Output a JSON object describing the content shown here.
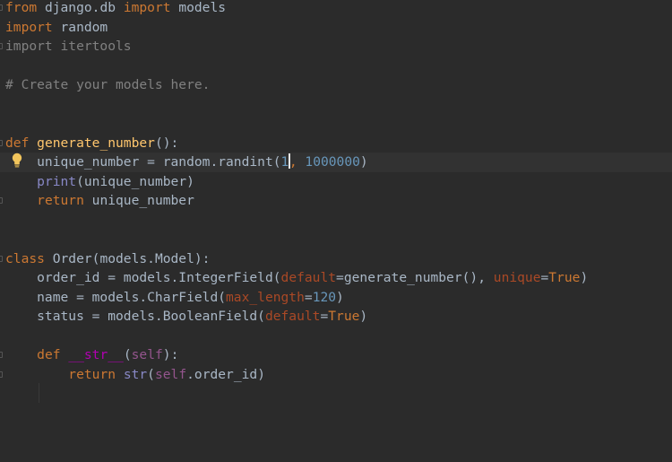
{
  "editor": {
    "lines": {
      "l1": {
        "kw1": "from",
        "mod": " django.db ",
        "kw2": "import",
        "name": " models"
      },
      "l2": {
        "kw": "import",
        "name": " random"
      },
      "l3": {
        "text": "import itertools"
      },
      "l5": {
        "text": "# Create your models here."
      },
      "l8": {
        "kw": "def",
        "sp": " ",
        "fn": "generate_number",
        "rest": "():"
      },
      "l9": {
        "a": "    unique_number = random.randint(",
        "n1": "1",
        "comma": ", ",
        "n2": "1000000",
        "close": ")"
      },
      "l10": {
        "indent": "    ",
        "builtin": "print",
        "rest": "(unique_number)"
      },
      "l11": {
        "indent": "    ",
        "kw": "return",
        "rest": " unique_number"
      },
      "l14": {
        "kw": "class",
        "rest": " Order(models.Model):"
      },
      "l15": {
        "a": "    order_id = models.IntegerField(",
        "kw1": "default",
        "b": "=generate_number(), ",
        "kw2": "unique",
        "eq": "=",
        "val": "True",
        "close": ")"
      },
      "l16": {
        "a": "    name = models.CharField(",
        "kw": "max_length",
        "eq": "=",
        "num": "120",
        "close": ")"
      },
      "l17": {
        "a": "    status = models.BooleanField(",
        "kw": "default",
        "eq": "=",
        "val": "True",
        "close": ")"
      },
      "l19": {
        "indent": "    ",
        "kw": "def",
        "sp": " ",
        "magic": "__str__",
        "open": "(",
        "self": "self",
        "close": "):"
      },
      "l20": {
        "indent": "        ",
        "kw": "return",
        "sp": " ",
        "builtin": "str",
        "open": "(",
        "self": "self",
        "rest": ".order_id)"
      }
    }
  },
  "icons": {
    "intention": "lightbulb-icon",
    "fold": "fold-marker-icon"
  },
  "colors": {
    "background": "#2b2b2b",
    "keyword": "#cc7832",
    "function": "#ffc66d",
    "number": "#6897bb",
    "comment": "#808080",
    "default_text": "#a9b7c6",
    "kwarg": "#aa4926",
    "self": "#94558d",
    "magic": "#b200b2",
    "builtin": "#8888c6",
    "bulb": "#f2c55c"
  }
}
